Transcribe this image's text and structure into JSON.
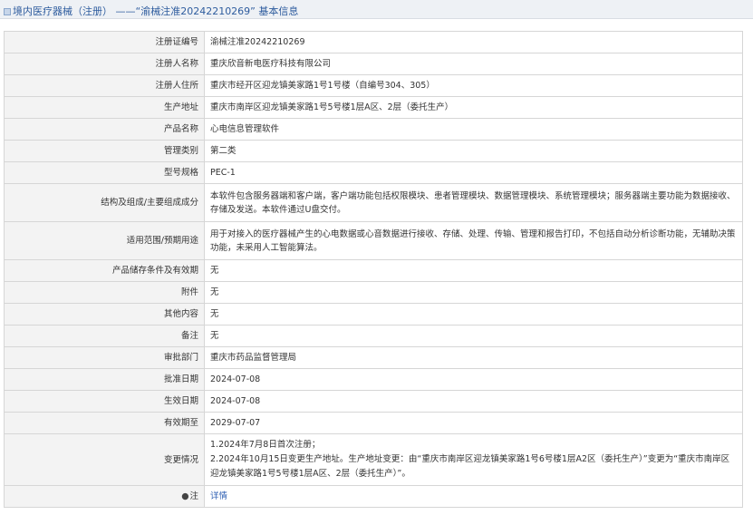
{
  "header": {
    "prefix": "境内医疗器械（注册）",
    "separator": "——",
    "title": "“渝械注准20242210269”",
    "suffix": "基本信息"
  },
  "rows": [
    {
      "label": "注册证编号",
      "value": "渝械注准20242210269"
    },
    {
      "label": "注册人名称",
      "value": "重庆欣音新电医疗科技有限公司"
    },
    {
      "label": "注册人住所",
      "value": "重庆市经开区迎龙镇美家路1号1号楼（自编号304、305）"
    },
    {
      "label": "生产地址",
      "value": "重庆市南岸区迎龙镇美家路1号5号楼1层A区、2层（委托生产）"
    },
    {
      "label": "产品名称",
      "value": "心电信息管理软件"
    },
    {
      "label": "管理类别",
      "value": "第二类"
    },
    {
      "label": "型号规格",
      "value": "PEC-1"
    },
    {
      "label": "结构及组成/主要组成成分",
      "value": "本软件包含服务器端和客户端，客户端功能包括权限模块、患者管理模块、数据管理模块、系统管理模块；服务器端主要功能为数据接收、存储及发送。本软件通过U盘交付。"
    },
    {
      "label": "适用范围/预期用途",
      "value": "用于对接入的医疗器械产生的心电数据或心音数据进行接收、存储、处理、传输、管理和报告打印，不包括自动分析诊断功能，无辅助决策功能，未采用人工智能算法。"
    },
    {
      "label": "产品储存条件及有效期",
      "value": "无"
    },
    {
      "label": "附件",
      "value": "无"
    },
    {
      "label": "其他内容",
      "value": "无"
    },
    {
      "label": "备注",
      "value": "无"
    },
    {
      "label": "审批部门",
      "value": "重庆市药品监督管理局"
    },
    {
      "label": "批准日期",
      "value": "2024-07-08"
    },
    {
      "label": "生效日期",
      "value": "2024-07-08"
    },
    {
      "label": "有效期至",
      "value": "2029-07-07"
    }
  ],
  "change": {
    "label": "变更情况",
    "line1": "1.2024年7月8日首次注册；",
    "line2": "2.2024年10月15日变更生产地址。生产地址变更：由“重庆市南岸区迎龙镇美家路1号6号楼1层A2区（委托生产）”变更为“重庆市南岸区迎龙镇美家路1号5号楼1层A区、2层（委托生产）”。"
  },
  "note": {
    "label_icon": "pin-icon",
    "label": "注",
    "link": "详情"
  }
}
